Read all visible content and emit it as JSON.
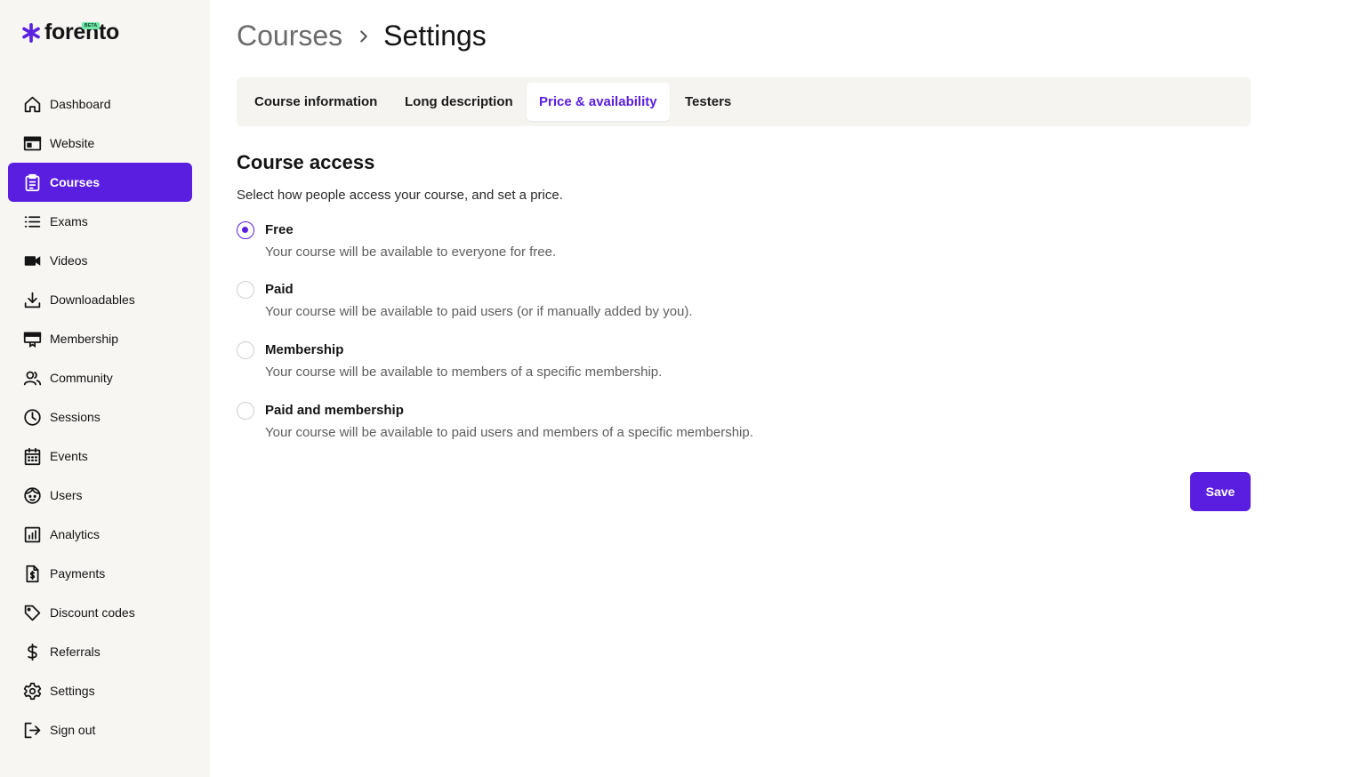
{
  "brand": {
    "name": "forento",
    "badge": "BETA",
    "accent": "#5a1ee0"
  },
  "sidebar": {
    "items": [
      {
        "label": "Dashboard",
        "icon": "home-icon",
        "active": false
      },
      {
        "label": "Website",
        "icon": "browser-window-icon",
        "active": false
      },
      {
        "label": "Courses",
        "icon": "clipboard-icon",
        "active": true
      },
      {
        "label": "Exams",
        "icon": "list-icon",
        "active": false
      },
      {
        "label": "Videos",
        "icon": "video-camera-icon",
        "active": false
      },
      {
        "label": "Downloadables",
        "icon": "download-icon",
        "active": false
      },
      {
        "label": "Membership",
        "icon": "membership-card-icon",
        "active": false
      },
      {
        "label": "Community",
        "icon": "people-icon",
        "active": false
      },
      {
        "label": "Sessions",
        "icon": "clock-icon",
        "active": false
      },
      {
        "label": "Events",
        "icon": "calendar-icon",
        "active": false
      },
      {
        "label": "Users",
        "icon": "face-icon",
        "active": false
      },
      {
        "label": "Analytics",
        "icon": "bar-chart-icon",
        "active": false
      },
      {
        "label": "Payments",
        "icon": "invoice-dollar-icon",
        "active": false
      },
      {
        "label": "Discount codes",
        "icon": "tag-icon",
        "active": false
      },
      {
        "label": "Referrals",
        "icon": "dollar-icon",
        "active": false
      },
      {
        "label": "Settings",
        "icon": "gear-icon",
        "active": false
      },
      {
        "label": "Sign out",
        "icon": "sign-out-icon",
        "active": false
      }
    ]
  },
  "header": {
    "parent": "Courses",
    "current": "Settings"
  },
  "tabs": [
    {
      "label": "Course information",
      "active": false
    },
    {
      "label": "Long description",
      "active": false
    },
    {
      "label": "Price & availability",
      "active": true
    },
    {
      "label": "Testers",
      "active": false
    }
  ],
  "section": {
    "title": "Course access",
    "description": "Select how people access your course, and set a price."
  },
  "options": [
    {
      "label": "Free",
      "description": "Your course will be available to everyone for free.",
      "selected": true
    },
    {
      "label": "Paid",
      "description": "Your course will be available to paid users (or if manually added by you).",
      "selected": false
    },
    {
      "label": "Membership",
      "description": "Your course will be available to members of a specific membership.",
      "selected": false
    },
    {
      "label": "Paid and membership",
      "description": "Your course will be available to paid users and members of a specific membership.",
      "selected": false
    }
  ],
  "actions": {
    "save_label": "Save"
  }
}
